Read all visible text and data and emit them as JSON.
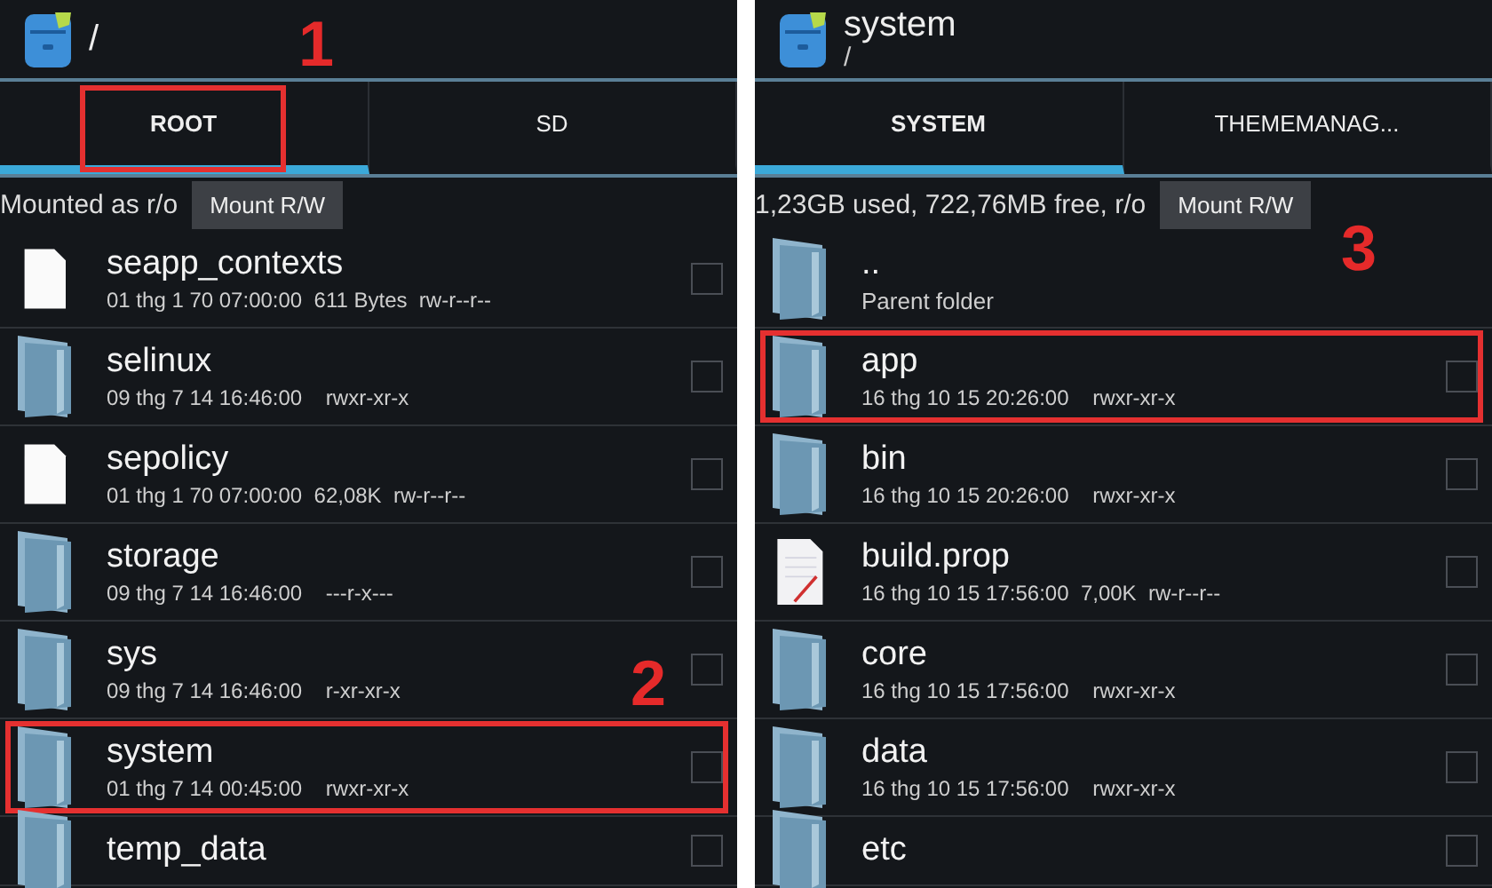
{
  "panels": [
    {
      "header": {
        "title": "/"
      },
      "tabs": [
        {
          "label": "ROOT",
          "selected": true,
          "highlighted": true,
          "callout": "1"
        },
        {
          "label": "SD",
          "selected": false
        }
      ],
      "info": {
        "text": "Mounted as r/o",
        "button": "Mount R/W"
      },
      "items": [
        {
          "kind": "file",
          "name": "seapp_contexts",
          "meta": "01 thg 1 70 07:00:00  611 Bytes  rw-r--r--",
          "checked": false
        },
        {
          "kind": "folder",
          "name": "selinux",
          "meta": "09 thg 7 14 16:46:00    rwxr-xr-x",
          "checked": false
        },
        {
          "kind": "file",
          "name": "sepolicy",
          "meta": "01 thg 1 70 07:00:00  62,08K  rw-r--r--",
          "checked": false
        },
        {
          "kind": "folder",
          "name": "storage",
          "meta": "09 thg 7 14 16:46:00    ---r-x---",
          "checked": false
        },
        {
          "kind": "folder",
          "name": "sys",
          "meta": "09 thg 7 14 16:46:00    r-xr-xr-x",
          "checked": false
        },
        {
          "kind": "folder",
          "name": "system",
          "meta": "01 thg 7 14 00:45:00    rwxr-xr-x",
          "checked": false,
          "highlighted": true,
          "callout": "2"
        },
        {
          "kind": "folder",
          "name": "temp_data",
          "checked": false
        }
      ]
    },
    {
      "header": {
        "title": "system",
        "subtitle": "/"
      },
      "tabs": [
        {
          "label": "SYSTEM",
          "selected": true
        },
        {
          "label": "THEMEMANAG...",
          "selected": false
        }
      ],
      "info": {
        "text": "1,23GB used, 722,76MB free, r/o",
        "button": "Mount R/W",
        "callout": "3"
      },
      "items": [
        {
          "kind": "parent",
          "name": "..",
          "meta": "Parent folder"
        },
        {
          "kind": "folder",
          "name": "app",
          "meta": "16 thg 10 15 20:26:00    rwxr-xr-x",
          "checked": false,
          "highlighted": true
        },
        {
          "kind": "folder",
          "name": "bin",
          "meta": "16 thg 10 15 20:26:00    rwxr-xr-x",
          "checked": false
        },
        {
          "kind": "edited-file",
          "name": "build.prop",
          "meta": "16 thg 10 15 17:56:00  7,00K  rw-r--r--",
          "checked": false
        },
        {
          "kind": "folder",
          "name": "core",
          "meta": "16 thg 10 15 17:56:00    rwxr-xr-x",
          "checked": false
        },
        {
          "kind": "folder",
          "name": "data",
          "meta": "16 thg 10 15 17:56:00    rwxr-xr-x",
          "checked": false
        },
        {
          "kind": "folder",
          "name": "etc",
          "checked": false
        }
      ]
    }
  ]
}
